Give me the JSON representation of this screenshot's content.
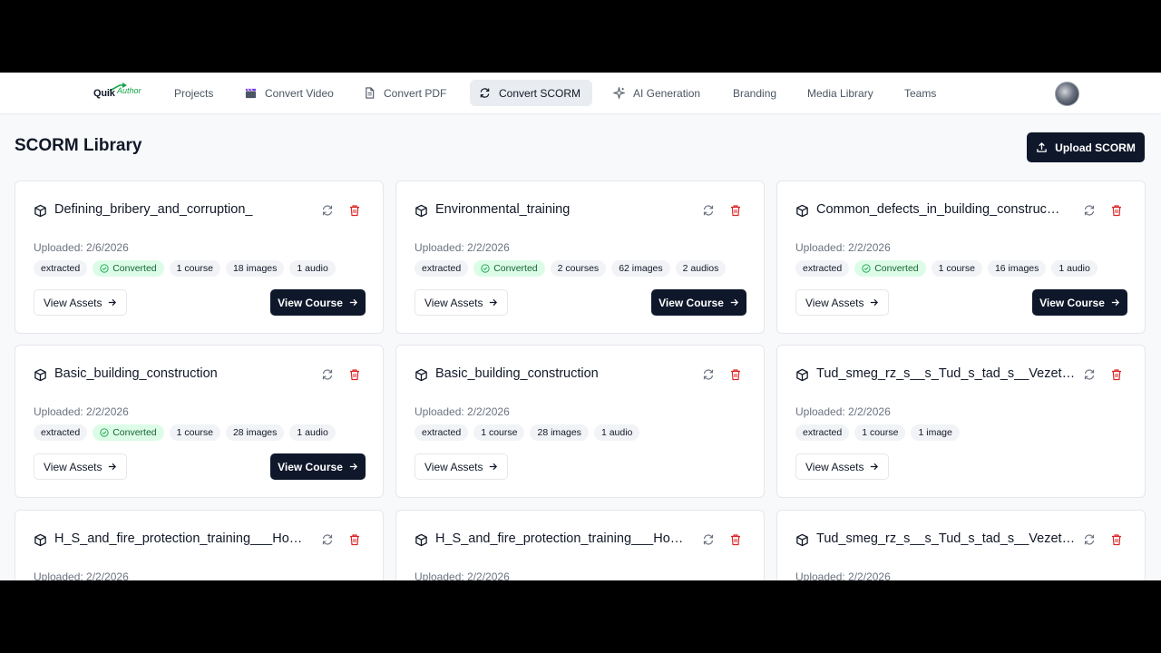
{
  "nav": {
    "logo_main": "Quik",
    "logo_sub": "Author",
    "items": [
      {
        "label": "Projects"
      },
      {
        "label": "Convert Video"
      },
      {
        "label": "Convert PDF"
      },
      {
        "label": "Convert SCORM"
      },
      {
        "label": "AI Generation"
      },
      {
        "label": "Branding"
      },
      {
        "label": "Media Library"
      },
      {
        "label": "Teams"
      }
    ],
    "active": "Convert SCORM"
  },
  "page": {
    "title": "SCORM Library",
    "upload_label": "Upload SCORM"
  },
  "actions": {
    "view_assets": "View Assets",
    "view_course": "View Course"
  },
  "cards": [
    {
      "title": "Defining_bribery_and_corruption_",
      "uploaded": "Uploaded: 2/6/2026",
      "tags": [
        "extracted",
        "Converted",
        "1 course",
        "18 images",
        "1 audio"
      ]
    },
    {
      "title": "Environmental_training",
      "uploaded": "Uploaded: 2/2/2026",
      "tags": [
        "extracted",
        "Converted",
        "2 courses",
        "62 images",
        "2 audios"
      ]
    },
    {
      "title": "Common_defects_in_building_construc…",
      "uploaded": "Uploaded: 2/2/2026",
      "tags": [
        "extracted",
        "Converted",
        "1 course",
        "16 images",
        "1 audio"
      ]
    },
    {
      "title": "Basic_building_construction",
      "uploaded": "Uploaded: 2/2/2026",
      "tags": [
        "extracted",
        "Converted",
        "1 course",
        "28 images",
        "1 audio"
      ]
    },
    {
      "title": "Basic_building_construction",
      "uploaded": "Uploaded: 2/2/2026",
      "tags": [
        "extracted",
        "1 course",
        "28 images",
        "1 audio"
      ]
    },
    {
      "title": "Tud_smeg_rz_s__s_Tud_s_tad_s__Vezet…",
      "uploaded": "Uploaded: 2/2/2026",
      "tags": [
        "extracted",
        "1 course",
        "1 image"
      ]
    },
    {
      "title": "H_S_and_fire_protection_training___Ho…",
      "uploaded": "Uploaded: 2/2/2026"
    },
    {
      "title": "H_S_and_fire_protection_training___Ho…",
      "uploaded": "Uploaded: 2/2/2026"
    },
    {
      "title": "Tud_smeg_rz_s__s_Tud_s_tad_s__Vezet…",
      "uploaded": "Uploaded: 2/2/2026"
    }
  ],
  "colors": {
    "primary": "#0f172a",
    "converted_bg": "#dcfce7",
    "converted_text": "#166534",
    "delete": "#dc2626"
  }
}
